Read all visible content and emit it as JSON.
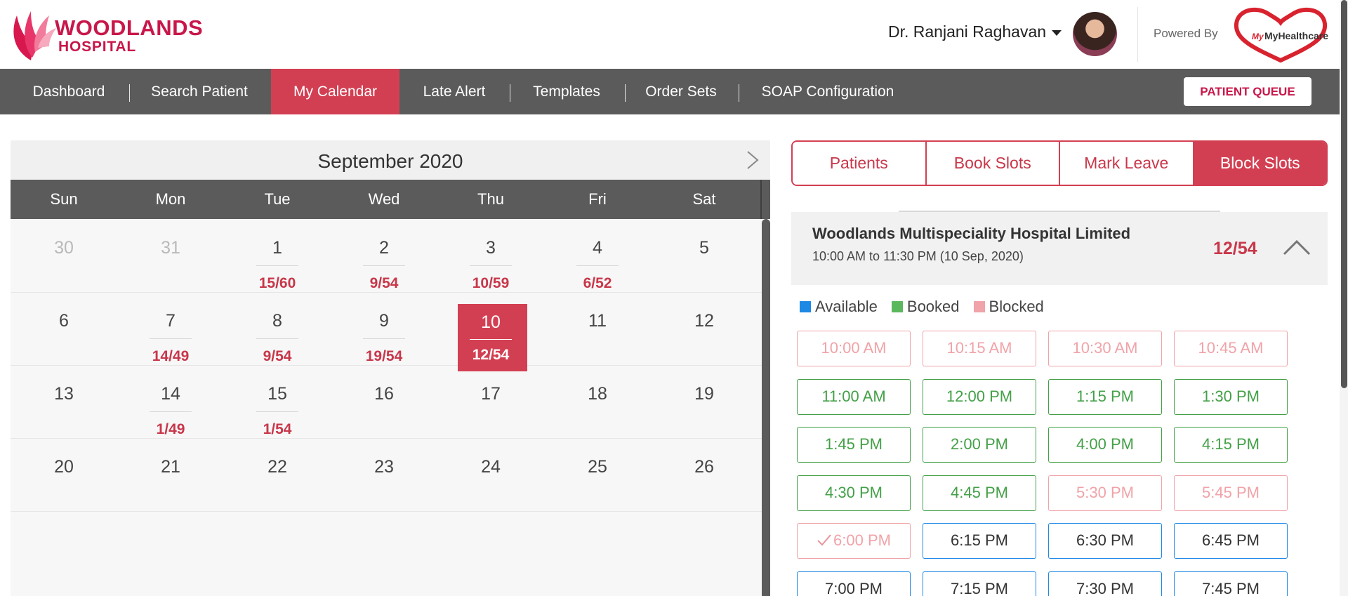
{
  "header": {
    "brand_line1": "WOODLANDS",
    "brand_line2": "HOSPITAL",
    "user_name": "Dr. Ranjani Raghavan",
    "powered_by": "Powered By",
    "partner_logo_text": "MyHealthcare"
  },
  "nav": {
    "items": [
      "Dashboard",
      "Search Patient",
      "My Calendar",
      "Late Alert",
      "Templates",
      "Order Sets",
      "SOAP Configuration"
    ],
    "active": "My Calendar",
    "queue_button": "PATIENT QUEUE"
  },
  "calendar": {
    "month_title": "September 2020",
    "weekdays": [
      "Sun",
      "Mon",
      "Tue",
      "Wed",
      "Thu",
      "Fri",
      "Sat"
    ],
    "weeks": [
      [
        {
          "d": "30",
          "muted": true
        },
        {
          "d": "31",
          "muted": true
        },
        {
          "d": "1",
          "c": "15/60"
        },
        {
          "d": "2",
          "c": "9/54"
        },
        {
          "d": "3",
          "c": "10/59"
        },
        {
          "d": "4",
          "c": "6/52"
        },
        {
          "d": "5"
        }
      ],
      [
        {
          "d": "6"
        },
        {
          "d": "7",
          "c": "14/49"
        },
        {
          "d": "8",
          "c": "9/54"
        },
        {
          "d": "9",
          "c": "19/54"
        },
        {
          "d": "10",
          "c": "12/54",
          "selected": true
        },
        {
          "d": "11"
        },
        {
          "d": "12"
        }
      ],
      [
        {
          "d": "13"
        },
        {
          "d": "14",
          "c": "1/49"
        },
        {
          "d": "15",
          "c": "1/54"
        },
        {
          "d": "16"
        },
        {
          "d": "17"
        },
        {
          "d": "18"
        },
        {
          "d": "19"
        }
      ],
      [
        {
          "d": "20"
        },
        {
          "d": "21"
        },
        {
          "d": "22"
        },
        {
          "d": "23"
        },
        {
          "d": "24"
        },
        {
          "d": "25"
        },
        {
          "d": "26"
        }
      ]
    ]
  },
  "panel": {
    "tabs": [
      "Patients",
      "Book Slots",
      "Mark Leave",
      "Block Slots"
    ],
    "active_tab": "Block Slots",
    "hospital_name": "Woodlands Multispeciality Hospital Limited",
    "hospital_time": "10:00 AM to 11:30 PM (10 Sep, 2020)",
    "hospital_count": "12/54",
    "legend": [
      {
        "label": "Available",
        "color": "#1e88e5"
      },
      {
        "label": "Booked",
        "color": "#5cb85c"
      },
      {
        "label": "Blocked",
        "color": "#f0a3a8"
      }
    ],
    "slots": [
      {
        "t": "10:00 AM",
        "s": "blocked"
      },
      {
        "t": "10:15 AM",
        "s": "blocked"
      },
      {
        "t": "10:30 AM",
        "s": "blocked"
      },
      {
        "t": "10:45 AM",
        "s": "blocked"
      },
      {
        "t": "11:00 AM",
        "s": "booked"
      },
      {
        "t": "12:00 PM",
        "s": "booked"
      },
      {
        "t": "1:15 PM",
        "s": "booked"
      },
      {
        "t": "1:30 PM",
        "s": "booked"
      },
      {
        "t": "1:45 PM",
        "s": "booked"
      },
      {
        "t": "2:00 PM",
        "s": "booked"
      },
      {
        "t": "4:00 PM",
        "s": "booked"
      },
      {
        "t": "4:15 PM",
        "s": "booked"
      },
      {
        "t": "4:30 PM",
        "s": "booked"
      },
      {
        "t": "4:45 PM",
        "s": "booked"
      },
      {
        "t": "5:30 PM",
        "s": "blocked"
      },
      {
        "t": "5:45 PM",
        "s": "blocked"
      },
      {
        "t": "6:00 PM",
        "s": "blocked",
        "checked": true
      },
      {
        "t": "6:15 PM",
        "s": "available"
      },
      {
        "t": "6:30 PM",
        "s": "available"
      },
      {
        "t": "6:45 PM",
        "s": "available"
      },
      {
        "t": "7:00 PM",
        "s": "available"
      },
      {
        "t": "7:15 PM",
        "s": "available"
      },
      {
        "t": "7:30 PM",
        "s": "available"
      },
      {
        "t": "7:45 PM",
        "s": "available"
      }
    ]
  }
}
